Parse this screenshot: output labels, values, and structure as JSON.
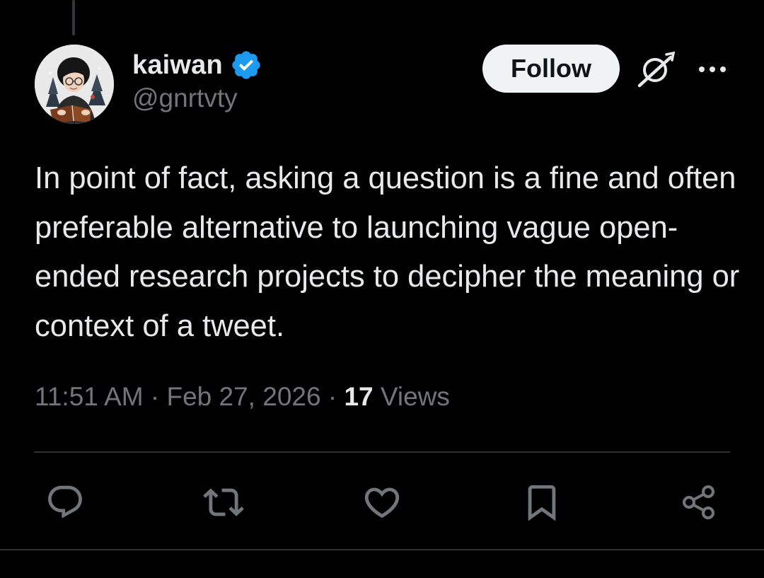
{
  "author": {
    "display_name": "kaiwan",
    "handle": "@gnrtvty",
    "verified": true
  },
  "header": {
    "follow_label": "Follow"
  },
  "tweet": {
    "text": "In point of fact, asking a question is a fine and often preferable alternative to launching vague open-ended research projects to decipher the meaning or context of a tweet."
  },
  "meta": {
    "time": "11:51 AM",
    "separator": "·",
    "date": "Feb 27, 2026",
    "views_count": "17",
    "views_label": "Views"
  },
  "actions": [
    "reply-icon",
    "retweet-icon",
    "like-icon",
    "bookmark-icon",
    "share-icon"
  ],
  "colors": {
    "background": "#000000",
    "text_primary": "#e7e9ea",
    "text_secondary": "#71767b",
    "verified_blue": "#1d9bf0",
    "follow_button_bg": "#eff3f4",
    "divider": "#2f3336"
  }
}
